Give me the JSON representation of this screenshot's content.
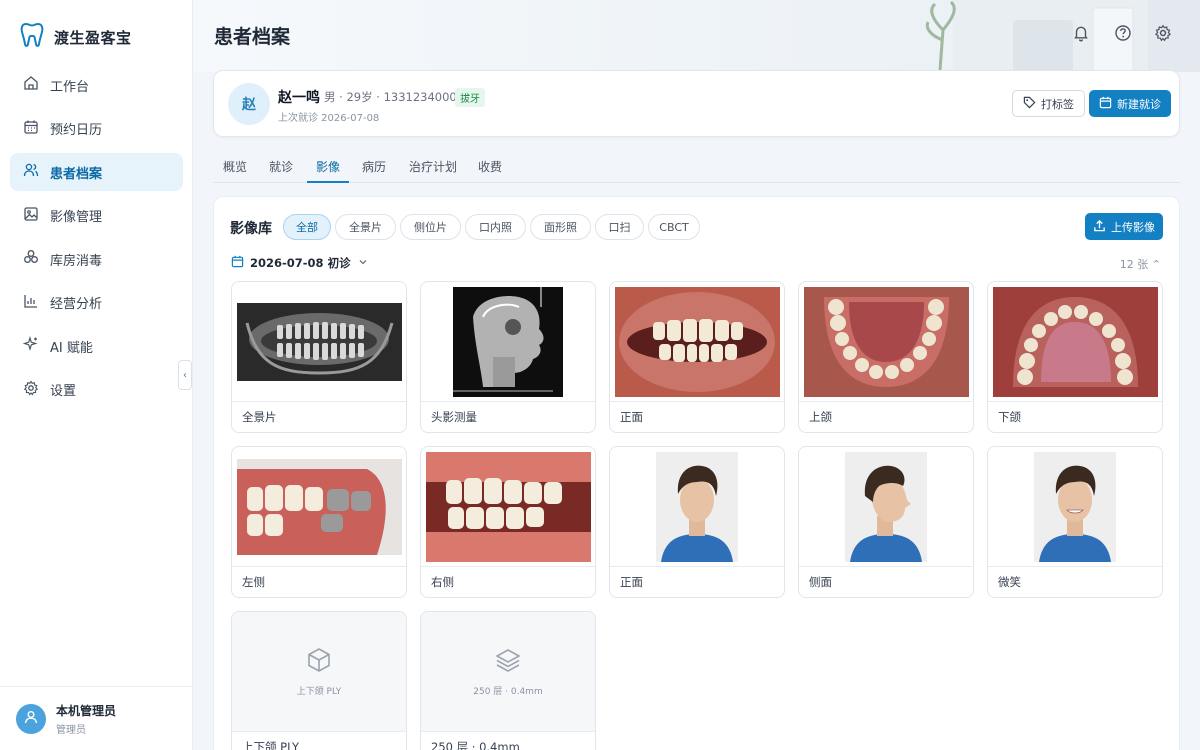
{
  "app": {
    "name": "渡生盈客宝"
  },
  "colors": {
    "accent": "#1380c3",
    "active_bg": "#e6f3fb",
    "badge_green": "#1f8a4c"
  },
  "sidebar": {
    "items": [
      {
        "label": "工作台",
        "icon": "home-icon"
      },
      {
        "label": "预约日历",
        "icon": "calendar-icon"
      },
      {
        "label": "患者档案",
        "icon": "users-icon",
        "active": true
      },
      {
        "label": "影像管理",
        "icon": "image-icon"
      },
      {
        "label": "库房消毒",
        "icon": "boxes-icon"
      },
      {
        "label": "经营分析",
        "icon": "bar-chart-icon"
      },
      {
        "label": "AI 赋能",
        "icon": "sparkle-icon"
      },
      {
        "label": "设置",
        "icon": "gear-icon"
      }
    ],
    "user": {
      "name": "本机管理员",
      "role": "管理员"
    }
  },
  "header": {
    "title": "患者档案"
  },
  "patient": {
    "avatar_char": "赵",
    "name": "赵一鸣",
    "meta": "男 · 29岁 · 13312340006",
    "badge": "拔牙",
    "last_visit": "上次就诊 2026-07-08",
    "tag_button": "打标签",
    "new_visit_button": "新建就诊"
  },
  "tabs": [
    "概览",
    "就诊",
    "影像",
    "病历",
    "治疗计划",
    "收费"
  ],
  "active_tab": "影像",
  "gallery": {
    "title": "影像库",
    "filters": [
      "全部",
      "全景片",
      "侧位片",
      "口内照",
      "面形照",
      "口扫",
      "CBCT"
    ],
    "active_filter": "全部",
    "upload_button": "上传影像",
    "date_group": "2026-07-08 初诊",
    "count": "12 张",
    "items": [
      {
        "label": "全景片",
        "kind": "panoramic-xray"
      },
      {
        "label": "头影测量",
        "kind": "cephalometric-xray"
      },
      {
        "label": "正面",
        "kind": "intraoral-front"
      },
      {
        "label": "上颌",
        "kind": "intraoral-upper"
      },
      {
        "label": "下颌",
        "kind": "intraoral-lower"
      },
      {
        "label": "左侧",
        "kind": "intraoral-left"
      },
      {
        "label": "右侧",
        "kind": "intraoral-right"
      },
      {
        "label": "正面",
        "kind": "face-front"
      },
      {
        "label": "侧面",
        "kind": "face-side"
      },
      {
        "label": "微笑",
        "kind": "face-smile"
      },
      {
        "label": "上下颌 PLY",
        "kind": "scan-3d",
        "caption": "上下颌 PLY"
      },
      {
        "label": "250 层 · 0.4mm",
        "kind": "cbct",
        "caption": "250 层 · 0.4mm"
      }
    ]
  }
}
